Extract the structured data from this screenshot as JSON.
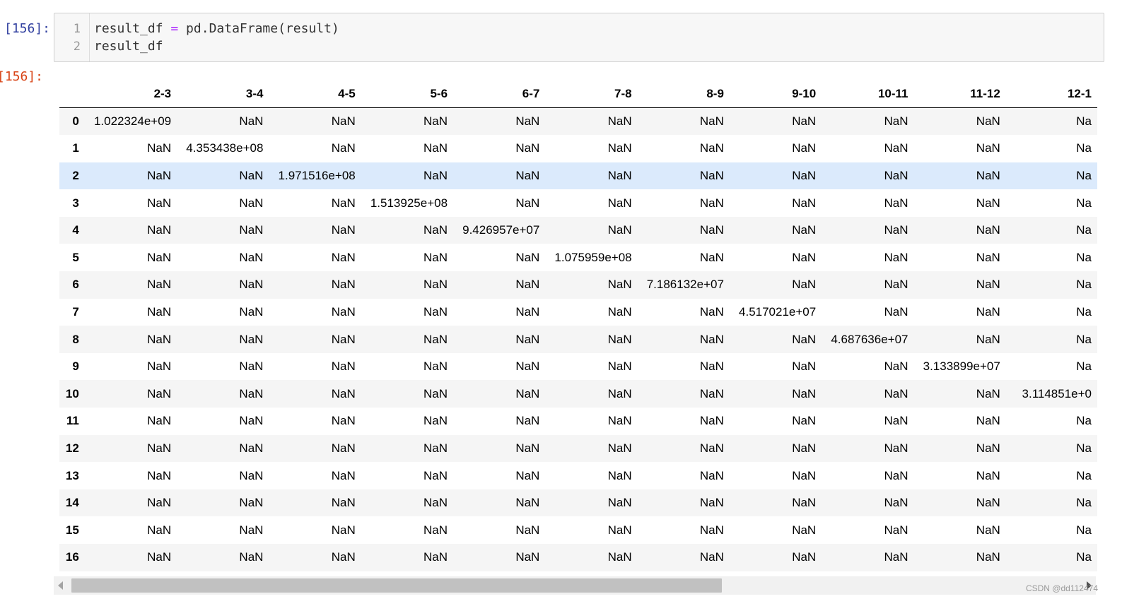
{
  "input_prompt": "[156]:",
  "output_prompt": "[156]:",
  "code": {
    "lines": [
      {
        "no": "1",
        "pre": "result_df ",
        "op": "=",
        "post": " pd.DataFrame(result)"
      },
      {
        "no": "2",
        "pre": "result_df",
        "op": "",
        "post": ""
      }
    ]
  },
  "table": {
    "columns": [
      "2-3",
      "3-4",
      "4-5",
      "5-6",
      "6-7",
      "7-8",
      "8-9",
      "9-10",
      "10-11",
      "11-12",
      "12-1"
    ],
    "highlighted_row": 2,
    "rows": [
      {
        "index": "0",
        "cells": [
          "1.022324e+09",
          "NaN",
          "NaN",
          "NaN",
          "NaN",
          "NaN",
          "NaN",
          "NaN",
          "NaN",
          "NaN",
          "Na"
        ]
      },
      {
        "index": "1",
        "cells": [
          "NaN",
          "4.353438e+08",
          "NaN",
          "NaN",
          "NaN",
          "NaN",
          "NaN",
          "NaN",
          "NaN",
          "NaN",
          "Na"
        ]
      },
      {
        "index": "2",
        "cells": [
          "NaN",
          "NaN",
          "1.971516e+08",
          "NaN",
          "NaN",
          "NaN",
          "NaN",
          "NaN",
          "NaN",
          "NaN",
          "Na"
        ]
      },
      {
        "index": "3",
        "cells": [
          "NaN",
          "NaN",
          "NaN",
          "1.513925e+08",
          "NaN",
          "NaN",
          "NaN",
          "NaN",
          "NaN",
          "NaN",
          "Na"
        ]
      },
      {
        "index": "4",
        "cells": [
          "NaN",
          "NaN",
          "NaN",
          "NaN",
          "9.426957e+07",
          "NaN",
          "NaN",
          "NaN",
          "NaN",
          "NaN",
          "Na"
        ]
      },
      {
        "index": "5",
        "cells": [
          "NaN",
          "NaN",
          "NaN",
          "NaN",
          "NaN",
          "1.075959e+08",
          "NaN",
          "NaN",
          "NaN",
          "NaN",
          "Na"
        ]
      },
      {
        "index": "6",
        "cells": [
          "NaN",
          "NaN",
          "NaN",
          "NaN",
          "NaN",
          "NaN",
          "7.186132e+07",
          "NaN",
          "NaN",
          "NaN",
          "Na"
        ]
      },
      {
        "index": "7",
        "cells": [
          "NaN",
          "NaN",
          "NaN",
          "NaN",
          "NaN",
          "NaN",
          "NaN",
          "4.517021e+07",
          "NaN",
          "NaN",
          "Na"
        ]
      },
      {
        "index": "8",
        "cells": [
          "NaN",
          "NaN",
          "NaN",
          "NaN",
          "NaN",
          "NaN",
          "NaN",
          "NaN",
          "4.687636e+07",
          "NaN",
          "Na"
        ]
      },
      {
        "index": "9",
        "cells": [
          "NaN",
          "NaN",
          "NaN",
          "NaN",
          "NaN",
          "NaN",
          "NaN",
          "NaN",
          "NaN",
          "3.133899e+07",
          "Na"
        ]
      },
      {
        "index": "10",
        "cells": [
          "NaN",
          "NaN",
          "NaN",
          "NaN",
          "NaN",
          "NaN",
          "NaN",
          "NaN",
          "NaN",
          "NaN",
          "3.114851e+0"
        ]
      },
      {
        "index": "11",
        "cells": [
          "NaN",
          "NaN",
          "NaN",
          "NaN",
          "NaN",
          "NaN",
          "NaN",
          "NaN",
          "NaN",
          "NaN",
          "Na"
        ]
      },
      {
        "index": "12",
        "cells": [
          "NaN",
          "NaN",
          "NaN",
          "NaN",
          "NaN",
          "NaN",
          "NaN",
          "NaN",
          "NaN",
          "NaN",
          "Na"
        ]
      },
      {
        "index": "13",
        "cells": [
          "NaN",
          "NaN",
          "NaN",
          "NaN",
          "NaN",
          "NaN",
          "NaN",
          "NaN",
          "NaN",
          "NaN",
          "Na"
        ]
      },
      {
        "index": "14",
        "cells": [
          "NaN",
          "NaN",
          "NaN",
          "NaN",
          "NaN",
          "NaN",
          "NaN",
          "NaN",
          "NaN",
          "NaN",
          "Na"
        ]
      },
      {
        "index": "15",
        "cells": [
          "NaN",
          "NaN",
          "NaN",
          "NaN",
          "NaN",
          "NaN",
          "NaN",
          "NaN",
          "NaN",
          "NaN",
          "Na"
        ]
      },
      {
        "index": "16",
        "cells": [
          "NaN",
          "NaN",
          "NaN",
          "NaN",
          "NaN",
          "NaN",
          "NaN",
          "NaN",
          "NaN",
          "NaN",
          "Na"
        ]
      }
    ]
  },
  "watermark": "CSDN @dd112474",
  "colors": {
    "input_prompt": "#303f9f",
    "output_prompt": "#d84315",
    "highlight_row": "#dbeafc",
    "stripe_row": "#f5f5f5"
  }
}
